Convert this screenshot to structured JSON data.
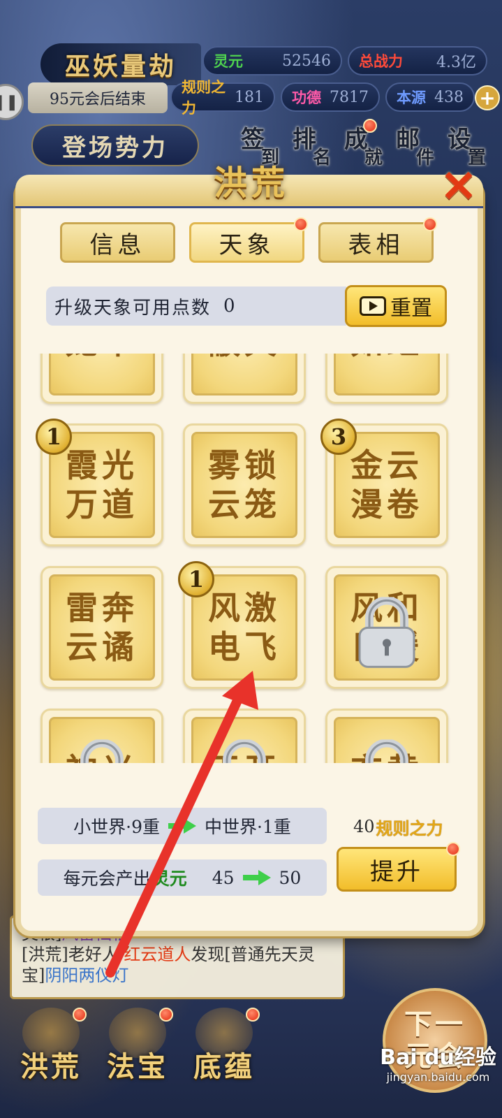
{
  "hud": {
    "game_mode": "巫妖量劫",
    "era_end": "95元会后结束",
    "stats_top": [
      {
        "label": "灵元",
        "value": "52546"
      },
      {
        "label": "总战力",
        "value": "4.3亿"
      }
    ],
    "stats_bottom": [
      {
        "label": "规则之力",
        "value": "181"
      },
      {
        "label": "功德",
        "value": "7817"
      },
      {
        "label": "本源",
        "value": "438"
      }
    ],
    "faction_button": "登场势力",
    "menu": [
      {
        "main": "签",
        "sub": "到"
      },
      {
        "main": "排",
        "sub": "名"
      },
      {
        "main": "成",
        "sub": "就"
      },
      {
        "main": "邮",
        "sub": "件"
      },
      {
        "main": "设",
        "sub": "置"
      }
    ]
  },
  "panel": {
    "title": "洪荒",
    "tabs": [
      "信息",
      "天象",
      "表相"
    ],
    "points_label": "升级天象可用点数",
    "points_value": "0",
    "reset_label": "重置",
    "cells": [
      {
        "text": "笼罩",
        "level": "",
        "locked": false
      },
      {
        "text": "蔽天",
        "level": "",
        "locked": false
      },
      {
        "text": "如虹",
        "level": "",
        "locked": false
      },
      {
        "text": "霞光万道",
        "level": "1",
        "locked": false
      },
      {
        "text": "雾锁云笼",
        "level": "",
        "locked": false
      },
      {
        "text": "金云漫卷",
        "level": "3",
        "locked": false
      },
      {
        "text": "雷奔云谲",
        "level": "",
        "locked": false
      },
      {
        "text": "风激电飞",
        "level": "1",
        "locked": false
      },
      {
        "text": "风和日暖",
        "level": "",
        "locked": true
      },
      {
        "text": "神光",
        "level": "",
        "locked": true
      },
      {
        "text": "天开",
        "level": "",
        "locked": true
      },
      {
        "text": "玄黄",
        "level": "",
        "locked": true
      }
    ],
    "tier_from": "小世界·9重",
    "tier_to": "中世界·1重",
    "output_label": "每元会产出",
    "output_resource": "灵元",
    "output_from": "45",
    "output_to": "50",
    "cost_value": "40",
    "cost_label": "规则之力",
    "upgrade_label": "提升"
  },
  "log": {
    "line1_prefix": "灵根]",
    "line1_name": "风雷仙根",
    "line2_tag": "[洪荒]老好人·",
    "line2_actor": "红云道人",
    "line2_mid": "发现[普通先天灵宝]",
    "line2_item": "阴阳两仪灯"
  },
  "nav": [
    "洪荒",
    "法宝",
    "底蕴"
  ],
  "next_era": [
    "下一",
    "元会"
  ],
  "watermark": {
    "brand": "Bai du经验",
    "url": "jingyan.baidu.com"
  },
  "colors": {
    "accent_gold": "#f2bd2a",
    "badge_red": "#e22a10",
    "arrow_red": "#e8322a",
    "panel_bg": "#fbf5e6"
  }
}
